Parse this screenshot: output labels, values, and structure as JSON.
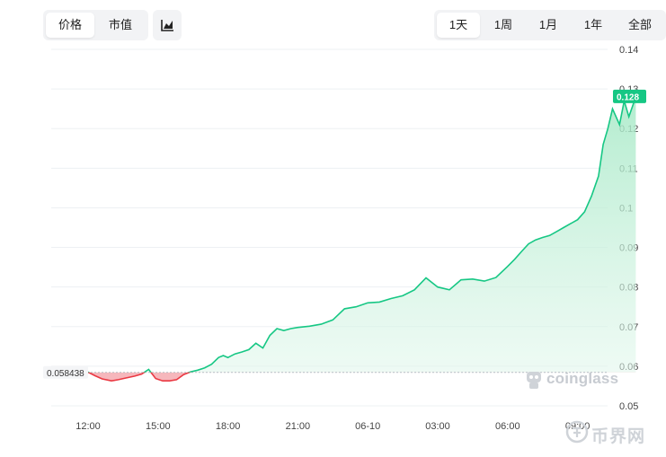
{
  "toolbar": {
    "metric_tabs": [
      {
        "label": "价格",
        "active": true
      },
      {
        "label": "市值",
        "active": false
      }
    ],
    "chart_type_icon": "area-chart-icon",
    "range_tabs": [
      {
        "label": "1天",
        "active": true
      },
      {
        "label": "1周",
        "active": false
      },
      {
        "label": "1月",
        "active": false
      },
      {
        "label": "1年",
        "active": false
      },
      {
        "label": "全部",
        "active": false
      }
    ]
  },
  "colors": {
    "up": "#16c784",
    "up_fill": "#c9f0dc",
    "down": "#ea3943",
    "down_fill": "#f6b7bc",
    "grid": "#edf0f3",
    "axis_text": "#444444"
  },
  "watermark": {
    "text": "coinglass",
    "icon": "coinglass-logo-icon"
  },
  "site_watermark": {
    "text": "币界网",
    "icon": "bijie-logo-icon"
  },
  "chart_data": {
    "type": "area",
    "title": "",
    "xlabel": "",
    "ylabel": "",
    "ylim": [
      0.05,
      0.14
    ],
    "yticks": [
      "0.14",
      "0.13",
      "0.12",
      "0.11",
      "0.1",
      "0.09",
      "0.08",
      "0.07",
      "0.06",
      "0.05"
    ],
    "xticks": [
      "12:00",
      "15:00",
      "18:00",
      "21:00",
      "06-10",
      "03:00",
      "06:00",
      "09:00"
    ],
    "baseline": 0.058438,
    "baseline_label": "0.058438",
    "last_value": 0.128,
    "last_label": "0.128",
    "grid": true,
    "x_hours": [
      -1.5,
      -1.3,
      -1.2,
      -0.7,
      -0.4,
      0,
      0.3,
      0.6,
      1.0,
      1.3,
      1.6,
      2.0,
      2.3,
      2.6,
      2.9,
      3.2,
      3.5,
      3.8,
      4.1,
      4.4,
      4.7,
      5.0,
      5.3,
      5.6,
      5.8,
      6.0,
      6.3,
      6.6,
      6.9,
      7.2,
      7.5,
      7.8,
      8.1,
      8.4,
      8.7,
      9.0,
      9.5,
      10.0,
      10.5,
      11.0,
      11.5,
      12.0,
      12.5,
      13.0,
      13.5,
      14.0,
      14.5,
      15.0,
      15.5,
      16.0,
      16.5,
      17.0,
      17.5,
      18.0,
      18.3,
      18.6,
      18.9,
      19.2,
      19.5,
      19.8,
      20.1,
      20.4,
      20.7,
      21.0,
      21.3,
      21.6,
      21.9,
      22.1,
      22.3,
      22.5,
      22.8,
      23.0,
      23.2,
      23.5,
      23.8,
      24.0,
      24.3,
      24.6,
      24.9,
      25.2,
      25.5,
      25.7,
      25.9,
      26.0,
      26.1,
      26.3,
      26.5,
      26.8,
      27.0,
      27.3,
      27.5
    ],
    "values": [
      0.0586,
      0.0597,
      0.0589,
      0.0586,
      0.0585,
      0.0585,
      0.0576,
      0.0568,
      0.0563,
      0.0566,
      0.057,
      0.0575,
      0.058,
      0.0592,
      0.0569,
      0.0563,
      0.0563,
      0.0566,
      0.0579,
      0.0586,
      0.059,
      0.0596,
      0.0605,
      0.0622,
      0.0627,
      0.0622,
      0.0631,
      0.0636,
      0.0642,
      0.0658,
      0.0646,
      0.0678,
      0.0695,
      0.069,
      0.0695,
      0.0698,
      0.0701,
      0.0706,
      0.0717,
      0.0745,
      0.075,
      0.076,
      0.0762,
      0.0771,
      0.0778,
      0.0793,
      0.0823,
      0.08,
      0.0793,
      0.0818,
      0.082,
      0.0815,
      0.0824,
      0.0852,
      0.087,
      0.089,
      0.0909,
      0.0919,
      0.0925,
      0.093,
      0.094,
      0.095,
      0.096,
      0.097,
      0.099,
      0.103,
      0.108,
      0.116,
      0.12,
      0.125,
      0.121,
      0.127,
      0.123,
      0.128
    ]
  }
}
